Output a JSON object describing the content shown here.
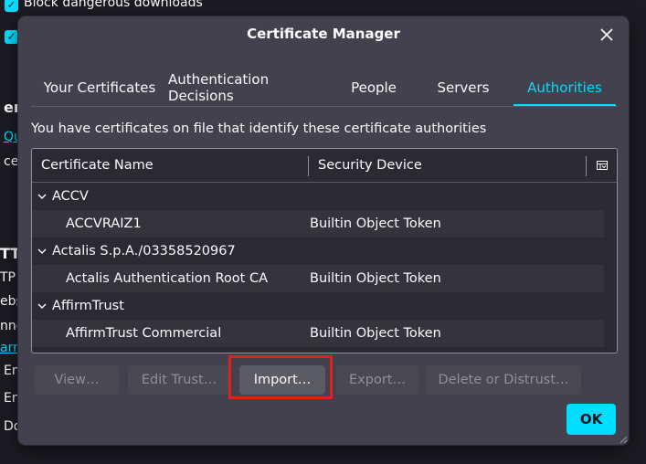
{
  "background": {
    "block_downloads": "Block dangerous downloads",
    "fragments": [
      "erti",
      "Qu",
      "ce",
      "TTP",
      "TP",
      "ebsi",
      "nne",
      "arn",
      "En",
      "En",
      "Do"
    ]
  },
  "dialog": {
    "title": "Certificate Manager",
    "tabs": [
      {
        "label": "Your Certificates"
      },
      {
        "label": "Authentication Decisions"
      },
      {
        "label": "People"
      },
      {
        "label": "Servers"
      },
      {
        "label": "Authorities"
      }
    ],
    "active_tab": "Authorities",
    "description": "You have certificates on file that identify these certificate authorities",
    "columns": {
      "name": "Certificate Name",
      "device": "Security Device"
    },
    "rows": [
      {
        "name": "ACCV",
        "device": "",
        "group": true
      },
      {
        "name": "ACCVRAIZ1",
        "device": "Builtin Object Token",
        "group": false
      },
      {
        "name": "Actalis S.p.A./03358520967",
        "device": "",
        "group": true
      },
      {
        "name": "Actalis Authentication Root CA",
        "device": "Builtin Object Token",
        "group": false
      },
      {
        "name": "AffirmTrust",
        "device": "",
        "group": true
      },
      {
        "name": "AffirmTrust Commercial",
        "device": "Builtin Object Token",
        "group": false
      }
    ],
    "buttons": {
      "view": "View…",
      "edit_trust": "Edit Trust…",
      "import": "Import…",
      "export": "Export…",
      "delete": "Delete or Distrust…",
      "ok": "OK"
    }
  },
  "colors": {
    "accent": "#00ddff",
    "highlight": "#e0201e",
    "dialog_bg": "#42414d"
  }
}
